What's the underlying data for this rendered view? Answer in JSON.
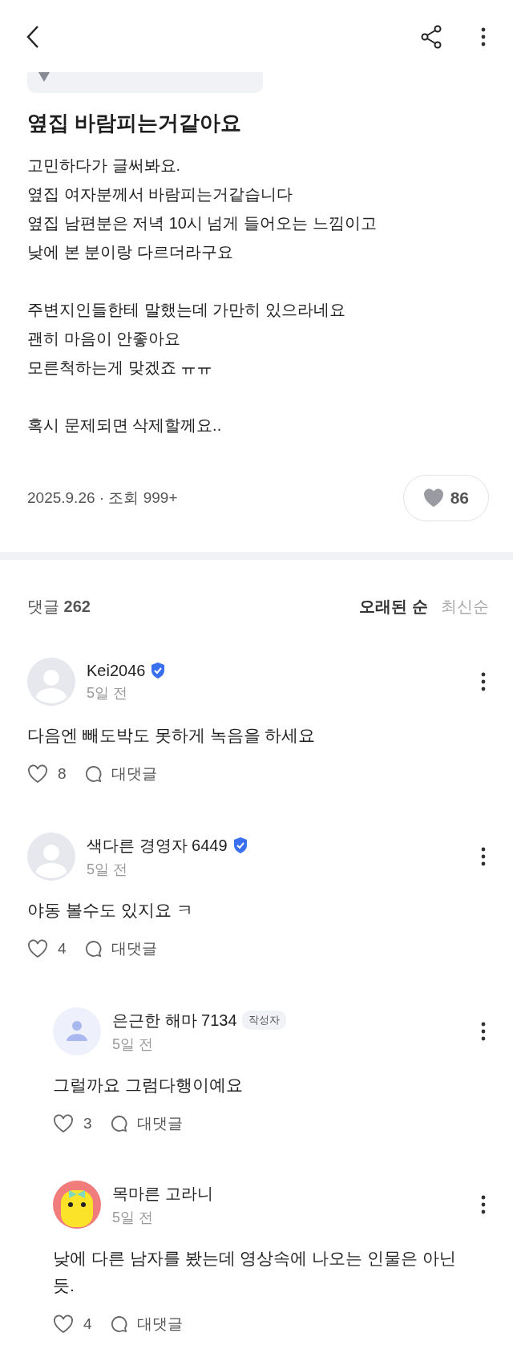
{
  "post": {
    "title": "옆집 바람피는거같아요",
    "paragraphs": [
      [
        "고민하다가 글써봐요.",
        "옆집 여자분께서 바람피는거같습니다",
        "옆집 남편분은 저녁 10시 넘게 들어오는 느낌이고",
        "낮에 본 분이랑 다르더라구요"
      ],
      [
        "주변지인들한테 말했는데 가만히 있으라네요",
        "괜히 마음이 안좋아요",
        "모른척하는게 맞겠죠 ㅠㅠ"
      ],
      [
        "혹시 문제되면 삭제할께요.."
      ]
    ],
    "date": "2025.9.26",
    "separator": "·",
    "views_label": "조회",
    "views": "999+",
    "likes": "86"
  },
  "comments_header": {
    "label": "댓글",
    "count": "262",
    "sort_options": [
      {
        "label": "오래된 순",
        "selected": true
      },
      {
        "label": "최신순",
        "selected": false
      }
    ]
  },
  "comments": [
    {
      "author": "Kei2046",
      "verified": true,
      "avatar": {
        "kind": "default"
      },
      "time": "5일 전",
      "text": "다음엔 빼도박도 못하게 녹음을 하세요",
      "likes": "8",
      "reply_label": "대댓글"
    },
    {
      "author": "색다른 경영자 6449",
      "verified": true,
      "avatar": {
        "kind": "default"
      },
      "time": "5일 전",
      "text": "야동 볼수도 있지요 ㅋ",
      "likes": "4",
      "reply_label": "대댓글",
      "children": [
        {
          "author": "은근한 해마 7134",
          "badge": "작성자",
          "verified": false,
          "avatar": {
            "kind": "author"
          },
          "time": "5일 전",
          "text": "그럴까요 그럼다행이예요",
          "likes": "3",
          "reply_label": "대댓글"
        },
        {
          "author": "목마른 고라니",
          "verified": false,
          "avatar": {
            "kind": "character"
          },
          "time": "5일 전",
          "text": "낮에 다른 남자를 봤는데 영상속에 나오는 인물은 아닌듯.",
          "likes": "4",
          "reply_label": "대댓글"
        }
      ]
    }
  ]
}
